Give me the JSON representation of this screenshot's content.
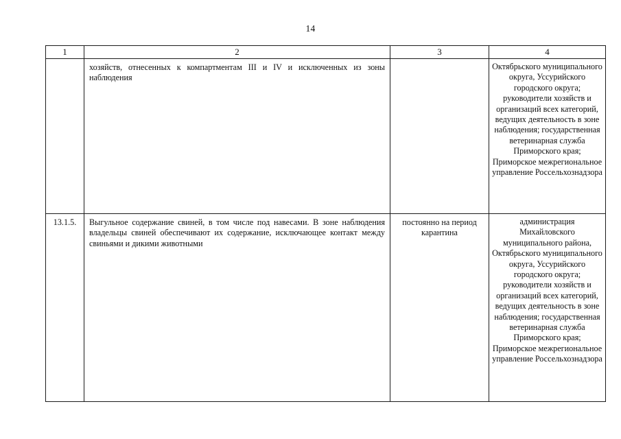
{
  "document": {
    "page_number": "14"
  },
  "table": {
    "header": {
      "col1": "1",
      "col2": "2",
      "col3": "3",
      "col4": "4"
    },
    "rows": [
      {
        "col1": "",
        "col2": "хозяйств, отнесенных к компартментам III и IV и исключенных из зоны наблюдения",
        "col3": "",
        "col4": "Октябрьского муниципального округа, Уссурийского городского округа; руководители хозяйств и организаций всех категорий, ведущих деятельность в зоне наблюдения; государственная ветеринарная служба Приморского края; Приморское межрегиональное управление Россельхознадзора"
      },
      {
        "col1": "13.1.5.",
        "col2": "Выгульное содержание свиней, в том числе под навесами. В зоне наблюдения владельцы свиней обеспечивают их содержание, исключающее контакт между свиньями и дикими животными",
        "col3": "постоянно на период карантина",
        "col4": "администрация Михайловского муниципального района, Октябрьского муниципального округа, Уссурийского городского округа; руководители хозяйств и организаций всех категорий, ведущих деятельность в зоне наблюдения; государственная ветеринарная служба Приморского края; Приморское межрегиональное управление Россельхознадзора"
      }
    ]
  }
}
